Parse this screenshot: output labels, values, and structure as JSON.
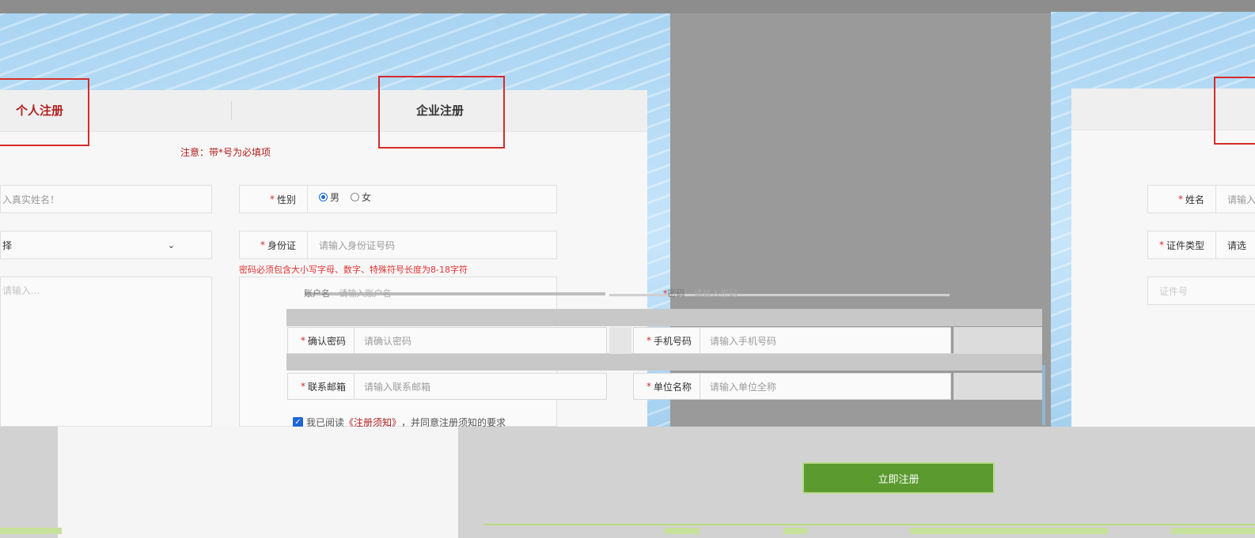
{
  "left_form": {
    "tabs": {
      "personal": "个人注册",
      "enterprise": "企业注册"
    },
    "notice": "注意：带*号为必填项",
    "name_placeholder_fragment": "入真实姓名！",
    "select_fragment": "择",
    "textarea_fragment": "请输入...",
    "gender": {
      "label": "性别",
      "male": "男",
      "female": "女"
    },
    "id_card": {
      "label": "身份证",
      "placeholder": "请输入身份证号码"
    },
    "password_hint": "密码必须包含大小写字母、数字、特殊符号长度为8-18字符"
  },
  "overlay_form": {
    "top_row": {
      "left_fragment": "账户名",
      "left_placeholder_fragment": "请输入账户名",
      "right_label": "密码",
      "right_placeholder": "请输入密码"
    },
    "confirm_password": {
      "label": "确认密码",
      "placeholder": "请确认密码"
    },
    "phone": {
      "label": "手机号码",
      "placeholder": "请输入手机号码"
    },
    "email": {
      "label": "联系邮箱",
      "placeholder": "请输入联系邮箱"
    },
    "company": {
      "label": "单位名称",
      "placeholder": "请输入单位全称"
    },
    "agreement": {
      "prefix": "我已阅读",
      "link": "《注册须知》",
      "suffix": "，并同意注册须知的要求"
    }
  },
  "right_form": {
    "name": {
      "label": "姓名",
      "placeholder_fragment": "请输入"
    },
    "cert_type": {
      "label": "证件类型",
      "value_fragment": "请选"
    },
    "third_fragment": "证件号"
  },
  "submit_label": "立即注册",
  "colors": {
    "accent_red": "#d62b2b",
    "submit_green": "#5b9a2f",
    "link_blue": "#1e66d6"
  }
}
